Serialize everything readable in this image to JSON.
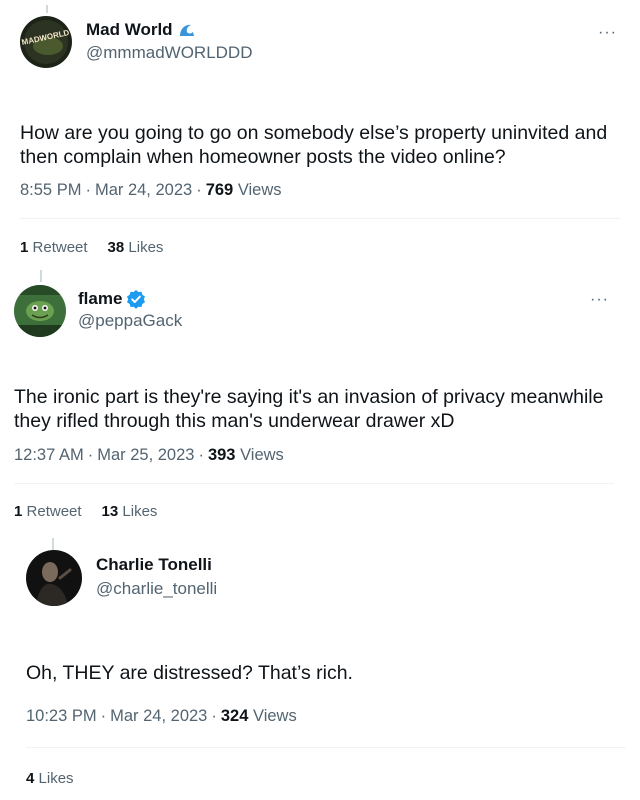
{
  "tweets": [
    {
      "name": "Mad World",
      "badge_icon": "wave-emoji-icon",
      "handle": "@mmmadWORLDDD",
      "avatar_text": "MADWORLD",
      "text": "How are you going to go on somebody else’s property uninvited and then complain when homeowner posts the video online?",
      "time": "8:55 PM",
      "date": "Mar 24, 2023",
      "views_count": "769",
      "views_label": "Views",
      "retweets_count": "1",
      "retweets_label": "Retweet",
      "likes_count": "38",
      "likes_label": "Likes",
      "more": "···"
    },
    {
      "name": "flame",
      "badge_icon": "verified-badge-icon",
      "handle": "@peppaGack",
      "text": "The ironic part is they're saying it's an invasion of privacy meanwhile they rifled through this man's underwear drawer xD",
      "time": "12:37 AM",
      "date": "Mar 25, 2023",
      "views_count": "393",
      "views_label": "Views",
      "retweets_count": "1",
      "retweets_label": "Retweet",
      "likes_count": "13",
      "likes_label": "Likes",
      "more": "···"
    },
    {
      "name": "Charlie Tonelli",
      "handle": "@charlie_tonelli",
      "text": "Oh, THEY are distressed? That’s rich.",
      "time": "10:23 PM",
      "date": "Mar 24, 2023",
      "views_count": "324",
      "views_label": "Views",
      "likes_count": "4",
      "likes_label": "Likes"
    }
  ],
  "separator": "·",
  "colors": {
    "text": "#0f1419",
    "secondary": "#536471",
    "verified": "#1d9bf0",
    "divider": "#eff3f4"
  }
}
